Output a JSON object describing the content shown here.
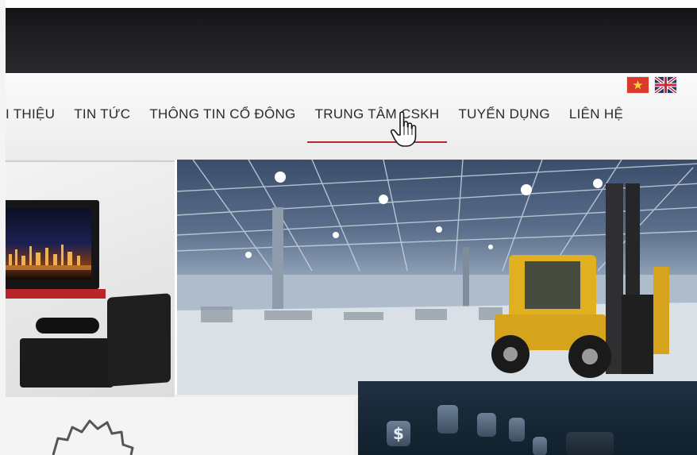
{
  "site": {
    "nav": {
      "items": [
        {
          "label": "I THIỆU",
          "active": false
        },
        {
          "label": "TIN TỨC",
          "active": false
        },
        {
          "label": "THÔNG TIN CỔ ĐÔNG",
          "active": false
        },
        {
          "label": "TRUNG TÂM CSKH",
          "active": true
        },
        {
          "label": "TUYỂN DỤNG",
          "active": false
        },
        {
          "label": "LIÊN HỆ",
          "active": false
        }
      ],
      "active_underline_color": "#b8272a"
    },
    "languages": [
      {
        "icon": "vietnam-flag-icon"
      },
      {
        "icon": "uk-flag-icon"
      }
    ]
  },
  "banners": {
    "bottom_right_icon_glyph": "$"
  },
  "colors": {
    "accent": "#b8272a",
    "nav_text": "#2a2a2a",
    "header_bg": "#f2f2f2"
  }
}
